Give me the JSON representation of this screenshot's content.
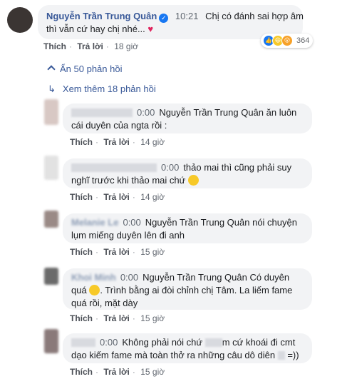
{
  "main_comment": {
    "author": "Nguyễn Trần Trung Quân",
    "time": "10:21",
    "text_line1": "Chị có đánh sai hợp âm",
    "text_line2": "thì vẫn cứ hay chị nhé...",
    "heart": "♥",
    "reaction_count": "364",
    "like": "Thích",
    "reply": "Trả lời",
    "age": "18 giờ"
  },
  "toggles": {
    "hide": "Ẩn 50 phản hồi",
    "more": "Xem thêm 18 phản hồi"
  },
  "replies": [
    {
      "time": "0:00",
      "line1": "Nguyễn Trần Trung Quân ăn luôn",
      "line2": "cái duyên của ngta rồi :",
      "like": "Thích",
      "reply": "Trả lời",
      "age": "14 giờ"
    },
    {
      "time": "0:00",
      "line1": "thảo mai thì cũng phải suy",
      "line2": "nghĩ trước khi thảo mai chứ",
      "like": "Thích",
      "reply": "Trả lời",
      "age": "14 giờ"
    },
    {
      "name": "Melanie Le",
      "time": "0:00",
      "line1": "Nguyễn Trần Trung Quân nói chuyện",
      "line2": "lụm miếng duyên lên đi anh",
      "like": "Thích",
      "reply": "Trả lời",
      "age": "15 giờ"
    },
    {
      "name": "Khoi Minh",
      "time": "0:00",
      "line1": "Nguyễn Trần Trung Quân Có duyên",
      "line2": "quá",
      "line2b": ". Trình bằng ai đòi chỉnh chị Tâm. La liếm fame",
      "line3": "quá rồi, mặt dày",
      "like": "Thích",
      "reply": "Trả lời",
      "age": "15 giờ"
    },
    {
      "time": "0:00",
      "line1a": "Không phải nói chứ",
      "line1b": "m cứ khoái đi cmt",
      "line2a": "dạo kiếm fame mà toàn thở ra những câu dô diên",
      "line2b": "=))",
      "like": "Thích",
      "reply": "Trả lời",
      "age": "15 giờ"
    }
  ]
}
